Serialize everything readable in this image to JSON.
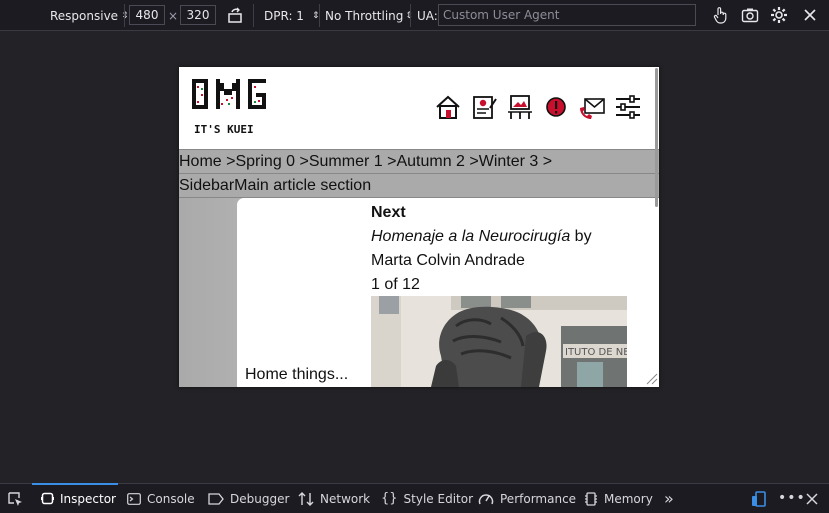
{
  "toolbar": {
    "device": "Responsive",
    "width": "480",
    "times": "×",
    "height": "320",
    "dpr": "DPR: 1",
    "throttling": "No Throttling",
    "ua_label": "UA:",
    "ua_placeholder": "Custom User Agent"
  },
  "site": {
    "logo_top": "OMG",
    "logo_bottom": "IT'S KUEI",
    "nav_icons": [
      "home-icon",
      "guestbook-icon",
      "gallery-icon",
      "info-icon",
      "contact-icon",
      "settings-sliders-icon"
    ],
    "breadcrumb": [
      "Home >",
      "Spring 0 >",
      "Summer 1 >",
      "Autumn 2 >",
      "Winter 3 >"
    ],
    "sections": "SidebarMain article section",
    "sidebar_text": "Home things...",
    "article": {
      "next": "Next",
      "title": "Homenaje a la Neurocirugía",
      "by": " by",
      "author": "Marta Colvin Andrade",
      "counter": "1 of 12"
    }
  },
  "devtools_tabs": [
    "Inspector",
    "Console",
    "Debugger",
    "Network",
    "Style Editor",
    "Performance",
    "Memory"
  ],
  "colors": {
    "accent": "#3a8ee6",
    "logo_red": "#c8102e"
  }
}
